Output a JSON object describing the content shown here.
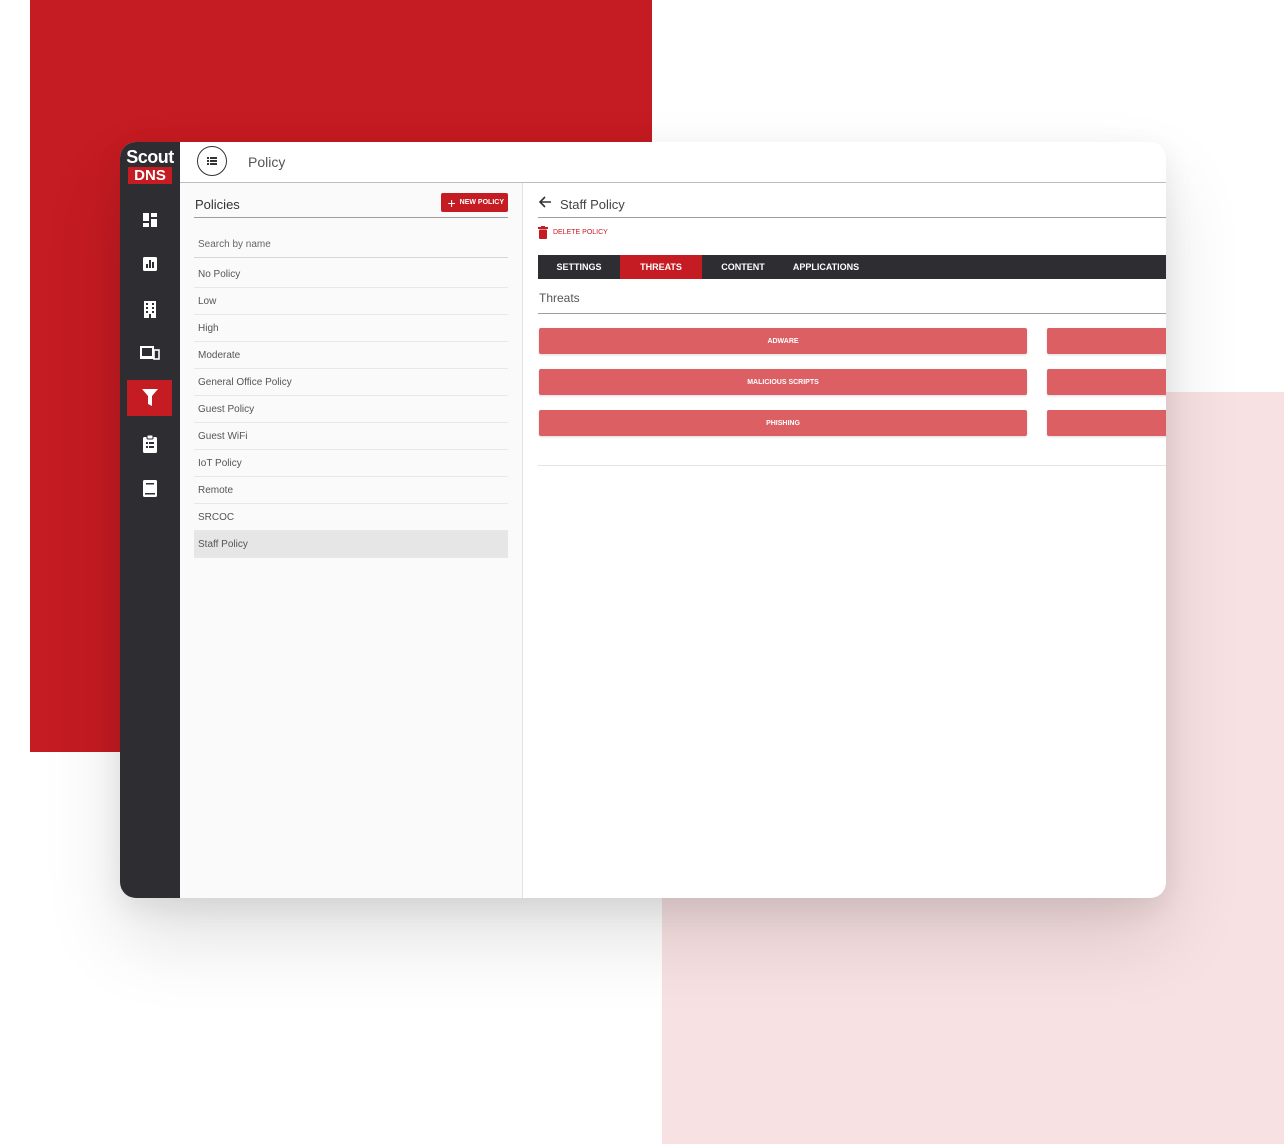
{
  "brand": {
    "logo_top": "Scout",
    "logo_bottom": "DNS",
    "accent_color": "#c51b22",
    "rail_color": "#2d2d32"
  },
  "rail": {
    "items": [
      {
        "icon": "dashboard-icon"
      },
      {
        "icon": "reports-chart-icon"
      },
      {
        "icon": "building-icon"
      },
      {
        "icon": "devices-icon"
      },
      {
        "icon": "filter-icon",
        "active": true
      },
      {
        "icon": "clipboard-list-icon"
      },
      {
        "icon": "book-icon"
      }
    ]
  },
  "topbar": {
    "menu_icon": "list-menu-icon",
    "title": "Policy"
  },
  "policies_panel": {
    "title": "Policies",
    "new_button": "NEW POLICY",
    "search_placeholder": "Search by name",
    "items": [
      "No Policy",
      "Low",
      "High",
      "Moderate",
      "General Office Policy",
      "Guest Policy",
      "Guest WiFi",
      "IoT Policy",
      "Remote",
      "SRCOC",
      "Staff Policy"
    ],
    "selected": "Staff Policy"
  },
  "detail": {
    "title": "Staff Policy",
    "delete_label": "DELETE POLICY",
    "tabs": [
      "SETTINGS",
      "THREATS",
      "CONTENT",
      "APPLICATIONS"
    ],
    "active_tab": "THREATS",
    "section_title": "Threats",
    "threats": [
      "ADWARE",
      "MALICIOUS SCRIPTS",
      "PHISHING"
    ],
    "threat_color": "#dc5f63"
  }
}
